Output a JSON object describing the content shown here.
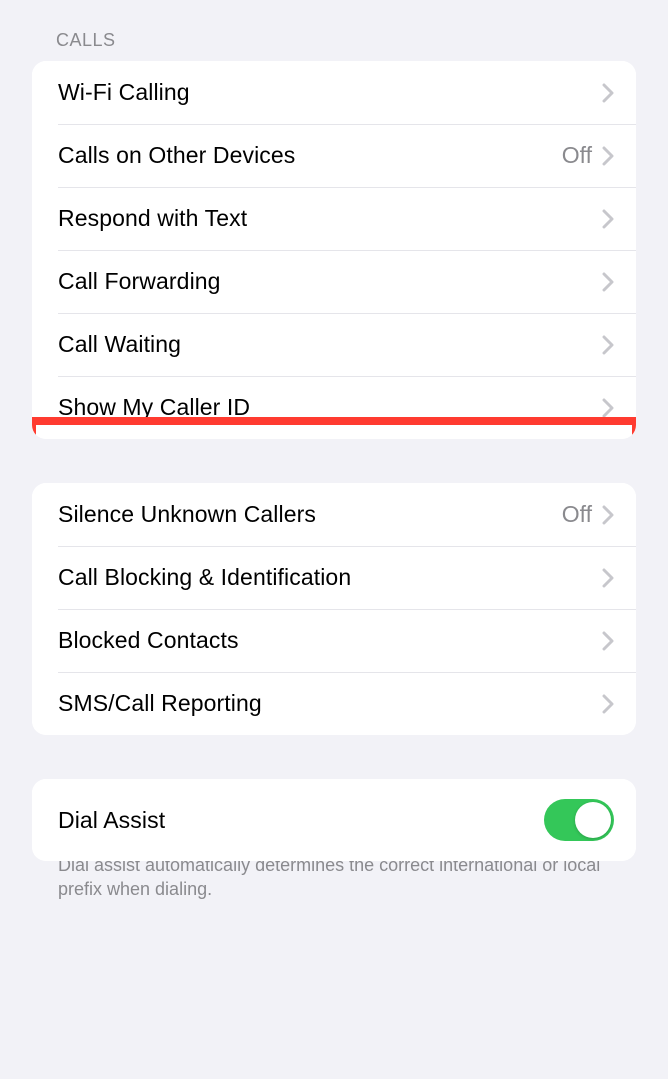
{
  "section_header": "Calls",
  "group1": {
    "items": [
      {
        "label": "Wi-Fi Calling",
        "value": ""
      },
      {
        "label": "Calls on Other Devices",
        "value": "Off"
      },
      {
        "label": "Respond with Text",
        "value": ""
      },
      {
        "label": "Call Forwarding",
        "value": ""
      },
      {
        "label": "Call Waiting",
        "value": ""
      },
      {
        "label": "Show My Caller ID",
        "value": ""
      }
    ]
  },
  "group2": {
    "items": [
      {
        "label": "Silence Unknown Callers",
        "value": "Off"
      },
      {
        "label": "Call Blocking & Identification",
        "value": ""
      },
      {
        "label": "Blocked Contacts",
        "value": ""
      },
      {
        "label": "SMS/Call Reporting",
        "value": ""
      }
    ]
  },
  "group3": {
    "label": "Dial Assist",
    "toggle_on": true
  },
  "footer": "Dial assist automatically determines the correct international or local prefix when dialing."
}
